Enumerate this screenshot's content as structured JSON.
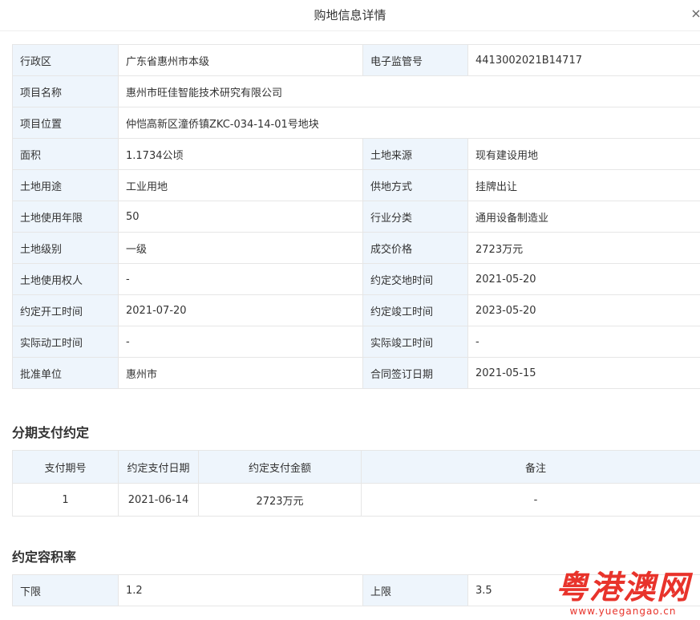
{
  "dialog": {
    "title": "购地信息详情"
  },
  "details": {
    "rows": [
      [
        {
          "k": "行政区",
          "v": "广东省惠州市本级"
        },
        {
          "k": "电子监管号",
          "v": "4413002021B14717"
        }
      ],
      [
        {
          "k": "项目名称",
          "v": "惠州市旺佳智能技术研究有限公司"
        }
      ],
      [
        {
          "k": "项目位置",
          "v": "仲恺高新区潼侨镇ZKC-034-14-01号地块"
        }
      ],
      [
        {
          "k": "面积",
          "v": "1.1734公顷"
        },
        {
          "k": "土地来源",
          "v": "现有建设用地"
        }
      ],
      [
        {
          "k": "土地用途",
          "v": "工业用地"
        },
        {
          "k": "供地方式",
          "v": "挂牌出让"
        }
      ],
      [
        {
          "k": "土地使用年限",
          "v": "50"
        },
        {
          "k": "行业分类",
          "v": "通用设备制造业"
        }
      ],
      [
        {
          "k": "土地级别",
          "v": "一级"
        },
        {
          "k": "成交价格",
          "v": "2723万元"
        }
      ],
      [
        {
          "k": "土地使用权人",
          "v": "-"
        },
        {
          "k": "约定交地时间",
          "v": "2021-05-20"
        }
      ],
      [
        {
          "k": "约定开工时间",
          "v": "2021-07-20"
        },
        {
          "k": "约定竣工时间",
          "v": "2023-05-20"
        }
      ],
      [
        {
          "k": "实际动工时间",
          "v": "-"
        },
        {
          "k": "实际竣工时间",
          "v": "-"
        }
      ],
      [
        {
          "k": "批准单位",
          "v": "惠州市"
        },
        {
          "k": "合同签订日期",
          "v": "2021-05-15"
        }
      ]
    ]
  },
  "installments": {
    "title": "分期支付约定",
    "headers": [
      "支付期号",
      "约定支付日期",
      "约定支付金额",
      "备注"
    ],
    "rows": [
      [
        "1",
        "2021-06-14",
        "2723万元",
        "-"
      ]
    ]
  },
  "far": {
    "title": "约定容积率",
    "lower_label": "下限",
    "lower_value": "1.2",
    "upper_label": "上限",
    "upper_value": "3.5"
  },
  "watermark": {
    "text": "粤港澳网",
    "url": "www.yuegangao.cn"
  },
  "colors": {
    "label_bg": "#eef5fc",
    "border": "#e6e6e6",
    "watermark": "#e8332b"
  },
  "icons": {
    "close": "close-icon"
  }
}
